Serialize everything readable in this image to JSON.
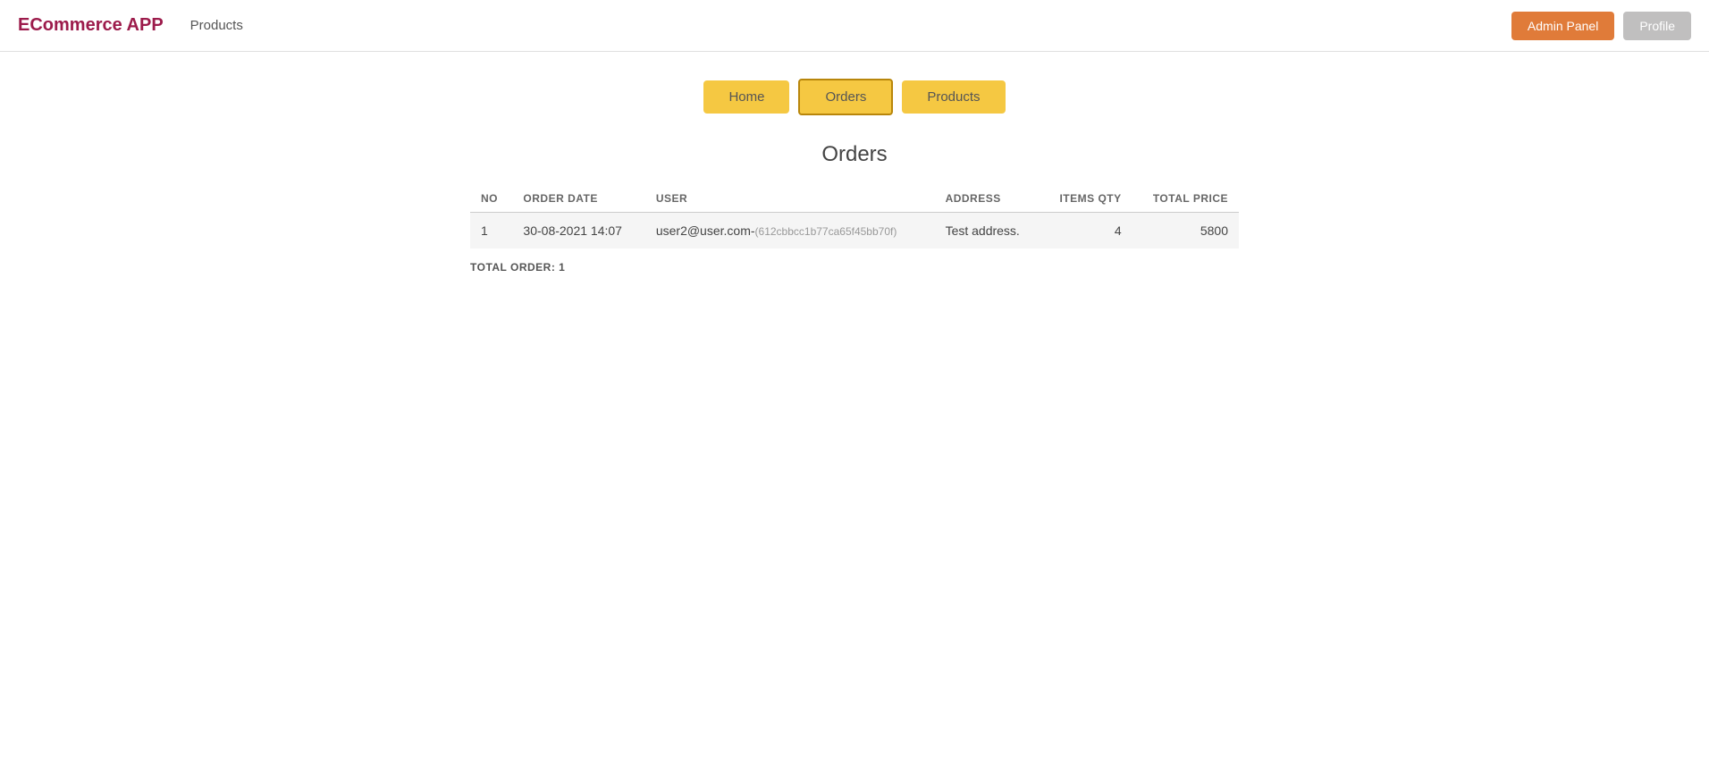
{
  "brand": {
    "label": "ECommerce APP"
  },
  "navbar": {
    "nav_link": "Products",
    "admin_button": "Admin Panel",
    "profile_button": "Profile"
  },
  "tabs": [
    {
      "id": "home",
      "label": "Home",
      "active": false
    },
    {
      "id": "orders",
      "label": "Orders",
      "active": true
    },
    {
      "id": "products",
      "label": "Products",
      "active": false
    }
  ],
  "orders_section": {
    "title": "Orders",
    "table": {
      "columns": [
        "NO",
        "ORDER DATE",
        "USER",
        "ADDRESS",
        "ITEMS QTY",
        "TOTAL PRICE"
      ],
      "rows": [
        {
          "no": "1",
          "order_date": "30-08-2021 14:07",
          "user_email": "user2@user.com-",
          "user_id": "(612cbbcc1b77ca65f45bb70f)",
          "address": "Test address.",
          "items_qty": "4",
          "total_price": "5800"
        }
      ]
    },
    "total_order_label": "TOTAL ORDER: 1"
  }
}
